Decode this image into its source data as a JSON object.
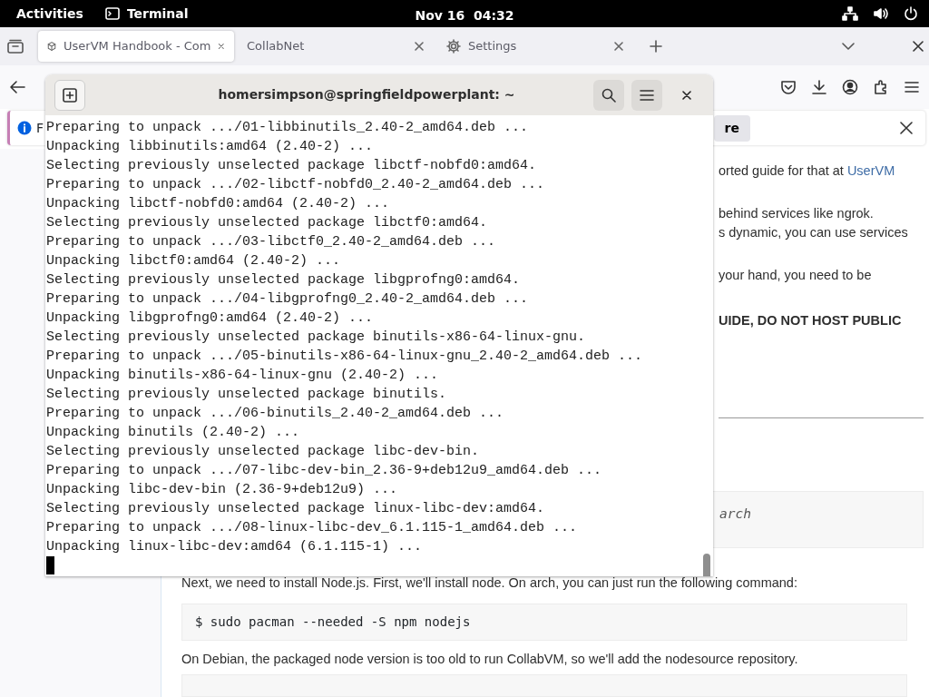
{
  "top_bar": {
    "activities": "Activities",
    "app": "Terminal",
    "clock": "Nov 16  04:32"
  },
  "browser": {
    "tabs": [
      {
        "title": "UserVM Handbook - Com",
        "kind": "page",
        "selected": true
      },
      {
        "title": "CollabNet",
        "kind": "plain",
        "selected": false
      },
      {
        "title": "Settings",
        "kind": "settings",
        "selected": false
      }
    ],
    "notification": {
      "text": "F",
      "button": "re"
    },
    "fragments": [
      {
        "kind": "text",
        "text": "orted guide for that at ",
        "link": "UserVM"
      },
      {
        "kind": "text",
        "text": "behind services like ngrok."
      },
      {
        "kind": "text",
        "text": "s dynamic, you can use services"
      },
      {
        "kind": "text",
        "text": "your hand, you need to be"
      },
      {
        "kind": "bold",
        "text": "UIDE, DO NOT HOST PUBLIC"
      },
      {
        "kind": "rule"
      },
      {
        "kind": "code",
        "text": "arch"
      }
    ],
    "blocks": [
      {
        "kind": "text",
        "text": "Next, we need to install Node.js. First, we'll install node. On arch, you can just run the following command:"
      },
      {
        "kind": "code",
        "text": "$ sudo pacman --needed -S npm nodejs"
      },
      {
        "kind": "text",
        "text": "On Debian, the packaged node version is too old to run CollabVM, so we'll add the nodesource repository."
      }
    ]
  },
  "terminal": {
    "title": "homersimpson@springfieldpowerplant: ~",
    "lines": [
      "Preparing to unpack .../01-libbinutils_2.40-2_amd64.deb ...",
      "Unpacking libbinutils:amd64 (2.40-2) ...",
      "Selecting previously unselected package libctf-nobfd0:amd64.",
      "Preparing to unpack .../02-libctf-nobfd0_2.40-2_amd64.deb ...",
      "Unpacking libctf-nobfd0:amd64 (2.40-2) ...",
      "Selecting previously unselected package libctf0:amd64.",
      "Preparing to unpack .../03-libctf0_2.40-2_amd64.deb ...",
      "Unpacking libctf0:amd64 (2.40-2) ...",
      "Selecting previously unselected package libgprofng0:amd64.",
      "Preparing to unpack .../04-libgprofng0_2.40-2_amd64.deb ...",
      "Unpacking libgprofng0:amd64 (2.40-2) ...",
      "Selecting previously unselected package binutils-x86-64-linux-gnu.",
      "Preparing to unpack .../05-binutils-x86-64-linux-gnu_2.40-2_amd64.deb ...",
      "Unpacking binutils-x86-64-linux-gnu (2.40-2) ...",
      "Selecting previously unselected package binutils.",
      "Preparing to unpack .../06-binutils_2.40-2_amd64.deb ...",
      "Unpacking binutils (2.40-2) ...",
      "Selecting previously unselected package libc-dev-bin.",
      "Preparing to unpack .../07-libc-dev-bin_2.36-9+deb12u9_amd64.deb ...",
      "Unpacking libc-dev-bin (2.36-9+deb12u9) ...",
      "Selecting previously unselected package linux-libc-dev:amd64.",
      "Preparing to unpack .../08-linux-libc-dev_6.1.115-1_amd64.deb ...",
      "Unpacking linux-libc-dev:amd64 (6.1.115-1) ..."
    ]
  }
}
